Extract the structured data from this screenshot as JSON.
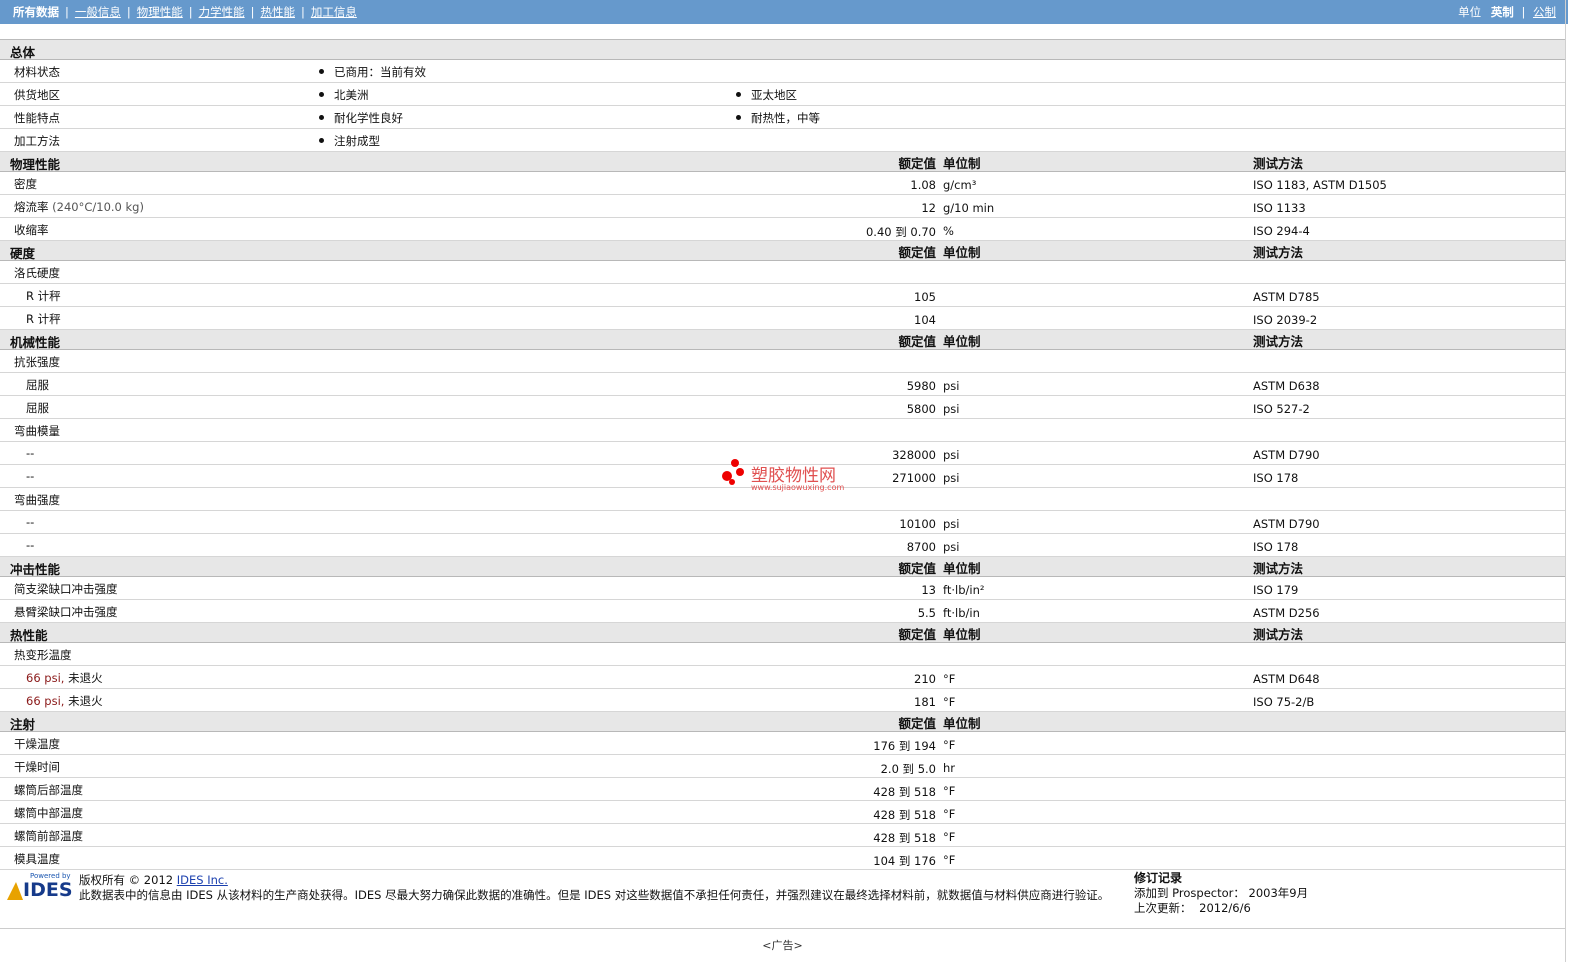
{
  "nav": {
    "items": [
      {
        "label": "所有数据",
        "current": true
      },
      {
        "label": "一般信息"
      },
      {
        "label": "物理性能"
      },
      {
        "label": "力学性能"
      },
      {
        "label": "热性能"
      },
      {
        "label": "加工信息"
      }
    ],
    "separator": "|",
    "units_label": "单位",
    "units_selected": "英制",
    "units_other": "公制"
  },
  "general": {
    "title": "总体",
    "rows": [
      {
        "label": "材料状态",
        "values": [
          "已商用：当前有效"
        ]
      },
      {
        "label": "供货地区",
        "values": [
          "北美洲",
          "亚太地区"
        ]
      },
      {
        "label": "性能特点",
        "values": [
          "耐化学性良好",
          "耐热性，中等"
        ]
      },
      {
        "label": "加工方法",
        "values": [
          "注射成型"
        ]
      }
    ]
  },
  "headers": {
    "value": "额定值",
    "unit": "单位制",
    "method": "测试方法"
  },
  "sections": [
    {
      "title": "物理性能",
      "show_method_header": true,
      "rows": [
        {
          "type": "prop",
          "label": "密度",
          "value": "1.08",
          "unit": "g/cm³",
          "method": "ISO 1183, ASTM D1505"
        },
        {
          "type": "prop",
          "label": "熔流率",
          "cond": "(240°C/10.0 kg)",
          "value": "12",
          "unit": "g/10 min",
          "method": "ISO 1133"
        },
        {
          "type": "prop",
          "label": "收缩率",
          "value": "0.40 到  0.70",
          "unit": "%",
          "method": "ISO 294-4"
        }
      ]
    },
    {
      "title": "硬度",
      "show_method_header": true,
      "rows": [
        {
          "type": "prop",
          "label": "洛氏硬度",
          "value": "",
          "unit": "",
          "method": ""
        },
        {
          "type": "sub",
          "label": "R 计秤",
          "value": "105",
          "unit": "",
          "method": "ASTM D785"
        },
        {
          "type": "sub",
          "label": "R 计秤",
          "value": "104",
          "unit": "",
          "method": "ISO 2039-2"
        }
      ]
    },
    {
      "title": "机械性能",
      "show_method_header": true,
      "rows": [
        {
          "type": "prop",
          "label": "抗张强度",
          "value": "",
          "unit": "",
          "method": ""
        },
        {
          "type": "sub",
          "label": "屈服",
          "value": "5980",
          "unit": "psi",
          "method": "ASTM D638"
        },
        {
          "type": "sub",
          "label": "屈服",
          "value": "5800",
          "unit": "psi",
          "method": "ISO 527-2"
        },
        {
          "type": "prop",
          "label": "弯曲模量",
          "value": "",
          "unit": "",
          "method": ""
        },
        {
          "type": "sub",
          "label": "--",
          "value": "328000",
          "unit": "psi",
          "method": "ASTM D790"
        },
        {
          "type": "sub",
          "label": "--",
          "value": "271000",
          "unit": "psi",
          "method": "ISO 178"
        },
        {
          "type": "prop",
          "label": "弯曲强度",
          "value": "",
          "unit": "",
          "method": ""
        },
        {
          "type": "sub",
          "label": "--",
          "value": "10100",
          "unit": "psi",
          "method": "ASTM D790"
        },
        {
          "type": "sub",
          "label": "--",
          "value": "8700",
          "unit": "psi",
          "method": "ISO 178"
        }
      ]
    },
    {
      "title": "冲击性能",
      "show_method_header": true,
      "rows": [
        {
          "type": "prop",
          "label": "简支梁缺口冲击强度",
          "value": "13",
          "unit": "ft·lb/in²",
          "method": "ISO 179"
        },
        {
          "type": "prop",
          "label": "悬臂梁缺口冲击强度",
          "value": "5.5",
          "unit": "ft·lb/in",
          "method": "ASTM D256"
        }
      ]
    },
    {
      "title": "热性能",
      "show_method_header": true,
      "rows": [
        {
          "type": "prop",
          "label": "热变形温度",
          "value": "",
          "unit": "",
          "method": ""
        },
        {
          "type": "sub",
          "label": "66 psi, 未退火",
          "red": "66 psi,",
          "rest": " 未退火",
          "value": "210",
          "unit": "°F",
          "method": "ASTM D648"
        },
        {
          "type": "sub",
          "label": "66 psi, 未退火",
          "red": "66 psi,",
          "rest": " 未退火",
          "value": "181",
          "unit": "°F",
          "method": "ISO 75-2/B"
        }
      ]
    },
    {
      "title": "注射",
      "show_method_header": false,
      "rows": [
        {
          "type": "prop",
          "label": "干燥温度",
          "value": "176 到  194",
          "unit": "°F",
          "method": ""
        },
        {
          "type": "prop",
          "label": "干燥时间",
          "value": "2.0 到  5.0",
          "unit": "hr",
          "method": ""
        },
        {
          "type": "prop",
          "label": "螺筒后部温度",
          "value": "428 到  518",
          "unit": "°F",
          "method": ""
        },
        {
          "type": "prop",
          "label": "螺筒中部温度",
          "value": "428 到  518",
          "unit": "°F",
          "method": ""
        },
        {
          "type": "prop",
          "label": "螺筒前部温度",
          "value": "428 到  518",
          "unit": "°F",
          "method": ""
        },
        {
          "type": "prop",
          "label": "模具温度",
          "value": "104 到  176",
          "unit": "°F",
          "method": ""
        }
      ]
    }
  ],
  "watermark": {
    "title": "塑胶物性网",
    "url": "www.sujiaowuxing.com"
  },
  "footer": {
    "logo_powered": "Powered by",
    "logo_text": "IDES",
    "copyright_prefix": "版权所有  © 2012 ",
    "copyright_link": "IDES Inc.",
    "disclaimer": "此数据表中的信息由  IDES 从该材料的生产商处获得。IDES 尽最大努力确保此数据的准确性。但是  IDES 对这些数据值不承担任何责任，并强烈建议在最终选择材料前，就数据值与材料供应商进行验证。",
    "revision_title": "修订记录",
    "added_label": "添加到  Prospector：",
    "added_value": "2003年9月",
    "updated_label": "上次更新：",
    "updated_value": "2012/6/6"
  },
  "ad_label": "<广告>"
}
